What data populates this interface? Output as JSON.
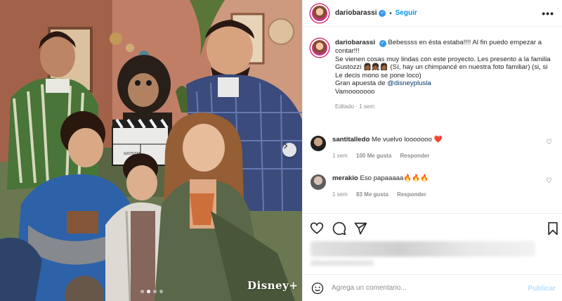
{
  "post": {
    "username": "dariobarassi",
    "separator": "•",
    "follow_label": "Seguir",
    "more_label": "•••",
    "media": {
      "watermark": "Disney+",
      "clapboard_text": "GUSTOZZI",
      "carousel_dots": 4,
      "active_dot": 1
    }
  },
  "caption": {
    "username": "dariobarassi",
    "text": "Bebessss en ésta estaba!!!! Al fin puedo empezar a contar!!!",
    "line2": "Se vienen cosas muy lindas con este proyecto. Les presento a la familia Gustozzi 👩🏾👧🏾👩🏾 (Sí, hay un chimpancé en nuestra foto familiar) (si, si Le decis mono se pone loco)",
    "line3_prefix": "Gran apuesta de ",
    "mention": "@disneyplusla",
    "line4": "Vamooooooo",
    "meta": "Editado · 1 sem"
  },
  "comments": [
    {
      "username": "santitalledo",
      "text": "Me vuelvo looooooo ❤️",
      "time": "1 sem",
      "likes": "100 Me gusta",
      "reply": "Responder"
    },
    {
      "username": "merakio",
      "text": "Eso papaaaaa🔥🔥🔥",
      "time": "1 sem",
      "likes": "83 Me gusta",
      "reply": "Responder"
    }
  ],
  "add_comment": {
    "placeholder": "Agrega un comentario...",
    "publish_label": "Publicar"
  },
  "icons": {
    "accent": "#0095f6",
    "verified": "#3897f0"
  }
}
